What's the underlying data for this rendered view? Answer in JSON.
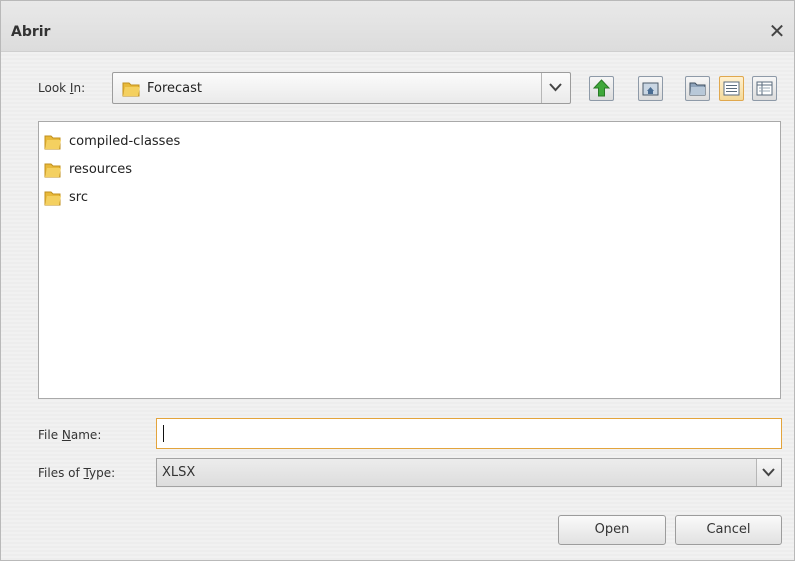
{
  "dialog": {
    "title": "Abrir",
    "close_glyph": "✕"
  },
  "lookin": {
    "label_pre": "Look ",
    "label_u": "I",
    "label_post": "n:",
    "value": "Forecast"
  },
  "toolbar": {
    "icons": [
      "up-folder-icon",
      "home-folder-icon",
      "new-folder-icon",
      "list-view-icon",
      "details-view-icon"
    ]
  },
  "files": [
    {
      "name": "compiled-classes",
      "icon": "folder-icon"
    },
    {
      "name": "resources",
      "icon": "folder-icon"
    },
    {
      "name": "src",
      "icon": "folder-icon"
    }
  ],
  "filename": {
    "label_pre": "File ",
    "label_u": "N",
    "label_post": "ame:",
    "value": ""
  },
  "filetype": {
    "label_pre": "Files of ",
    "label_u": "T",
    "label_post": "ype:",
    "value": "XLSX"
  },
  "buttons": {
    "open": "Open",
    "cancel": "Cancel"
  },
  "colors": {
    "accent": "#e3a43c",
    "folder": "#e8b93a",
    "up_arrow": "#3fa83a"
  }
}
